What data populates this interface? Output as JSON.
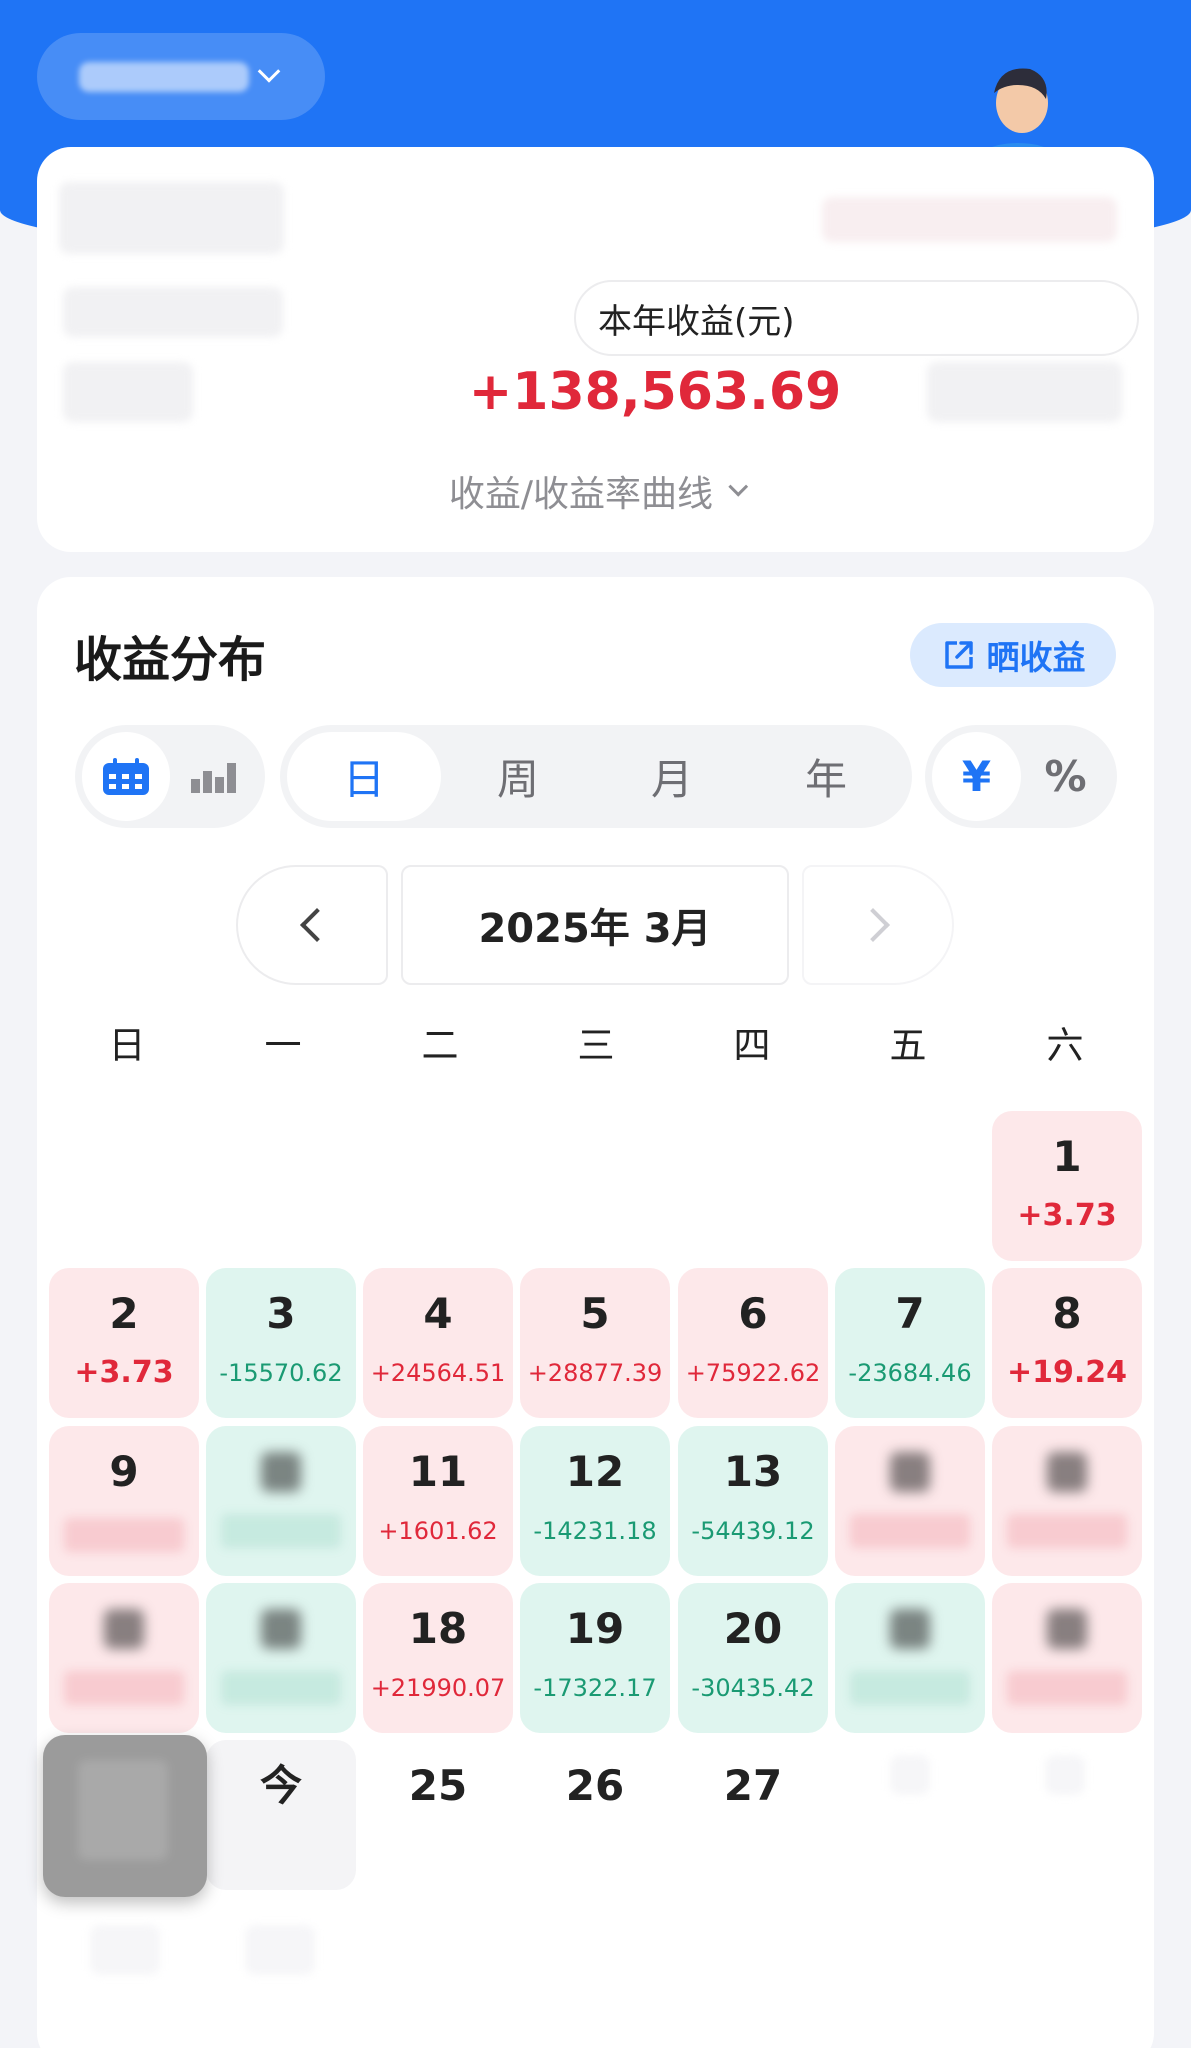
{
  "header": {
    "account_chevron_icon": "chevron-down-icon",
    "mascot_icon": "mascot-character"
  },
  "summary": {
    "year_label": "本年收益(元)",
    "year_value": "+138,563.69",
    "curve_toggle": "收益/收益率曲线"
  },
  "distribution": {
    "title": "收益分布",
    "share_label": "晒收益",
    "view_toggle": [
      {
        "icon": "calendar-icon",
        "active": true
      },
      {
        "icon": "bar-chart-icon",
        "active": false
      }
    ],
    "periods": [
      {
        "label": "日",
        "active": true
      },
      {
        "label": "周",
        "active": false
      },
      {
        "label": "月",
        "active": false
      },
      {
        "label": "年",
        "active": false
      }
    ],
    "units": [
      {
        "label": "¥",
        "active": true
      },
      {
        "label": "%",
        "active": false
      }
    ],
    "month_label": "2025年 3月",
    "weekdays": [
      "日",
      "一",
      "二",
      "三",
      "四",
      "五",
      "六"
    ]
  },
  "calendar": {
    "row1": [
      {
        "day": "1",
        "value": "+3.73",
        "type": "pos",
        "big": true
      }
    ],
    "row2": [
      {
        "day": "2",
        "value": "+3.73",
        "type": "pos",
        "big": true
      },
      {
        "day": "3",
        "value": "-15570.62",
        "type": "neg"
      },
      {
        "day": "4",
        "value": "+24564.51",
        "type": "pos"
      },
      {
        "day": "5",
        "value": "+28877.39",
        "type": "pos"
      },
      {
        "day": "6",
        "value": "+75922.62",
        "type": "pos"
      },
      {
        "day": "7",
        "value": "-23684.46",
        "type": "neg"
      },
      {
        "day": "8",
        "value": "+19.24",
        "type": "pos",
        "big": true
      }
    ],
    "row3": [
      {
        "day": "9",
        "type": "pos"
      },
      {
        "type": "neg"
      },
      {
        "day": "11",
        "value": "+1601.62",
        "type": "pos"
      },
      {
        "day": "12",
        "value": "-14231.18",
        "type": "neg"
      },
      {
        "day": "13",
        "value": "-54439.12",
        "type": "neg"
      },
      {
        "type": "pos"
      },
      {
        "type": "pos"
      }
    ],
    "row4": [
      {
        "type": "pos"
      },
      {
        "type": "neg"
      },
      {
        "day": "18",
        "value": "+21990.07",
        "type": "pos"
      },
      {
        "day": "19",
        "value": "-17322.17",
        "type": "neg"
      },
      {
        "day": "20",
        "value": "-30435.42",
        "type": "neg"
      },
      {
        "type": "neg"
      },
      {
        "type": "pos"
      }
    ],
    "row5": [
      {
        "type": "hidden"
      },
      {
        "day": "今",
        "type": "today"
      },
      {
        "day": "25",
        "type": "plain"
      },
      {
        "day": "26",
        "type": "plain"
      },
      {
        "day": "27",
        "type": "plain"
      }
    ],
    "colors": {
      "positive": "#e0283a",
      "negative": "#1a9a73",
      "accent": "#1f74f5"
    }
  }
}
